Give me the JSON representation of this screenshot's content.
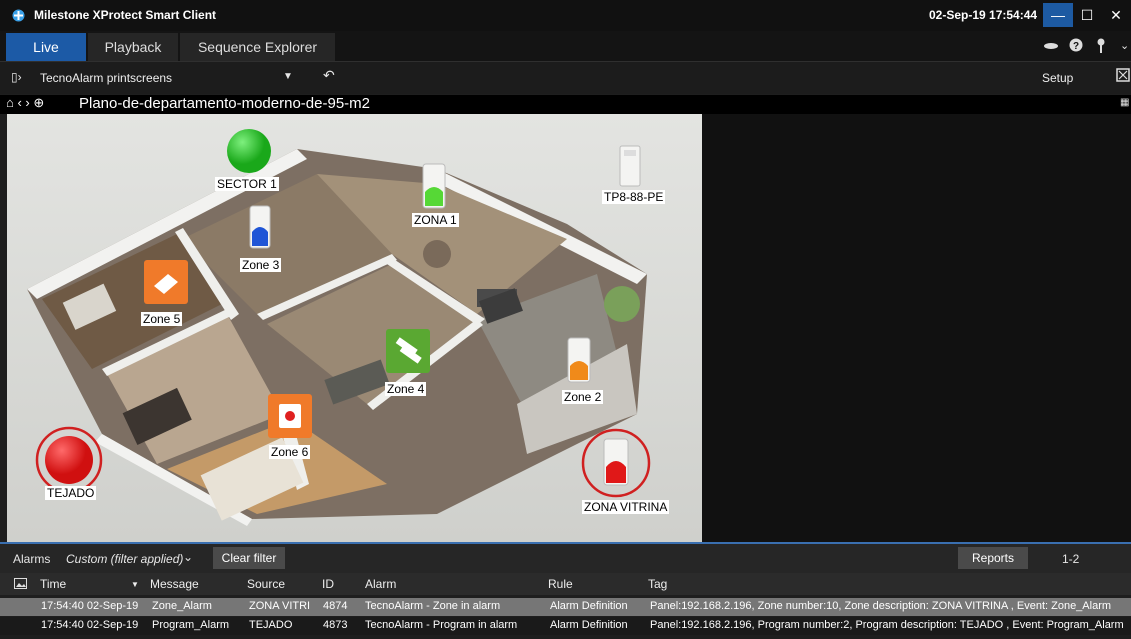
{
  "window": {
    "title": "Milestone XProtect Smart Client",
    "clock": "02-Sep-19 17:54:44",
    "min": "—",
    "max": "☐",
    "close": "✕"
  },
  "tabs": [
    "Live",
    "Playback",
    "Sequence Explorer"
  ],
  "viewbar": {
    "view_name": "TecnoAlarm printscreens",
    "setup": "Setup"
  },
  "map": {
    "title": "Plano-de-departamento-moderno-de-95-m2",
    "labels": {
      "sector1": "SECTOR 1",
      "tp8": "TP8-88-PE",
      "zona1": "ZONA 1",
      "zone3": "Zone 3",
      "zone5": "Zone 5",
      "zone4": "Zone 4",
      "zone2": "Zone 2",
      "zone6": "Zone 6",
      "tejado": "TEJADO",
      "vitrina": "ZONA VITRINA"
    }
  },
  "alarms": {
    "label": "Alarms",
    "filter": "Custom (filter applied)",
    "clear_filter": "Clear filter",
    "reports": "Reports",
    "count": "1-2",
    "columns": [
      "Time",
      "Message",
      "Source",
      "ID",
      "Alarm",
      "Rule",
      "Tag"
    ],
    "rows": [
      {
        "time": "17:54:40 02-Sep-19",
        "message": "Zone_Alarm",
        "source": "ZONA VITRI",
        "id": "4874",
        "alarm": "TecnoAlarm - Zone in alarm",
        "rule": "Alarm Definition",
        "tag": "Panel:192.168.2.196, Zone number:10, Zone description: ZONA VITRINA , Event: Zone_Alarm"
      },
      {
        "time": "17:54:40 02-Sep-19",
        "message": "Program_Alarm",
        "source": "TEJADO",
        "id": "4873",
        "alarm": "TecnoAlarm - Program in alarm",
        "rule": "Alarm Definition",
        "tag": "Panel:192.168.2.196, Program number:2, Program description: TEJADO , Event: Program_Alarm"
      }
    ]
  },
  "colors": {
    "accent": "#1c5aa6",
    "sensor_green": "#2fc12f",
    "sensor_red": "#e02020",
    "zone_orange": "#f07a2a",
    "zone_green": "#5aa832"
  }
}
